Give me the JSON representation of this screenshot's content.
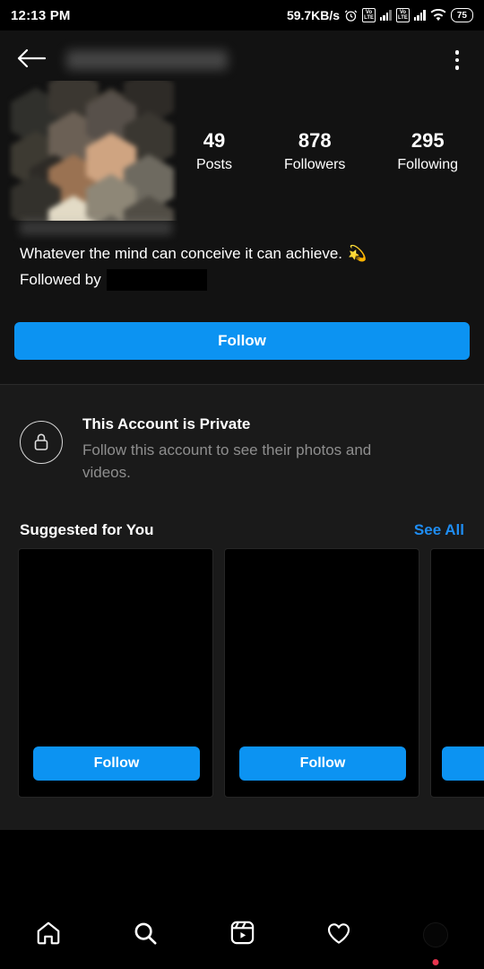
{
  "statusbar": {
    "time": "12:13 PM",
    "network_speed": "59.7KB/s",
    "alarm_icon": "alarm-clock-icon",
    "volte_label_top": "Vo",
    "volte_label_bottom": "LTE",
    "wifi_icon": "wifi-icon",
    "battery_level": "75"
  },
  "appbar": {
    "back_icon": "back-arrow-icon",
    "username_redacted": "",
    "overflow_icon": "three-dot-menu-icon"
  },
  "profile": {
    "avatar_label": "profile-picture-censored",
    "display_name_redacted": "",
    "stats": [
      {
        "value": "49",
        "label": "Posts"
      },
      {
        "value": "878",
        "label": "Followers"
      },
      {
        "value": "295",
        "label": "Following"
      }
    ],
    "bio": "Whatever the mind can conceive it can achieve.",
    "bio_emoji": "💫",
    "followed_by_prefix": "Followed by",
    "followed_by_redacted": "",
    "follow_button": "Follow"
  },
  "private_notice": {
    "lock_icon": "lock-icon",
    "title": "This Account is Private",
    "subtitle": "Follow this account to see their photos and videos."
  },
  "suggested": {
    "title": "Suggested for You",
    "see_all": "See All",
    "cards": [
      {
        "follow_label": "Follow",
        "partial": false
      },
      {
        "follow_label": "Follow",
        "partial": false
      },
      {
        "follow_label": "",
        "partial": true
      }
    ]
  },
  "bottom_nav": [
    {
      "name": "home",
      "icon": "home-icon"
    },
    {
      "name": "search",
      "icon": "search-icon"
    },
    {
      "name": "reels",
      "icon": "reels-icon"
    },
    {
      "name": "activity",
      "icon": "heart-icon"
    },
    {
      "name": "profile",
      "icon": "profile-avatar-icon",
      "badge": true
    }
  ],
  "colors": {
    "accent_blue": "#0c93f2",
    "link_blue": "#1f8df2",
    "background": "#000000",
    "surface": "#1a1a1a",
    "muted_text": "#8e8e8e",
    "badge_red": "#e8344e"
  }
}
